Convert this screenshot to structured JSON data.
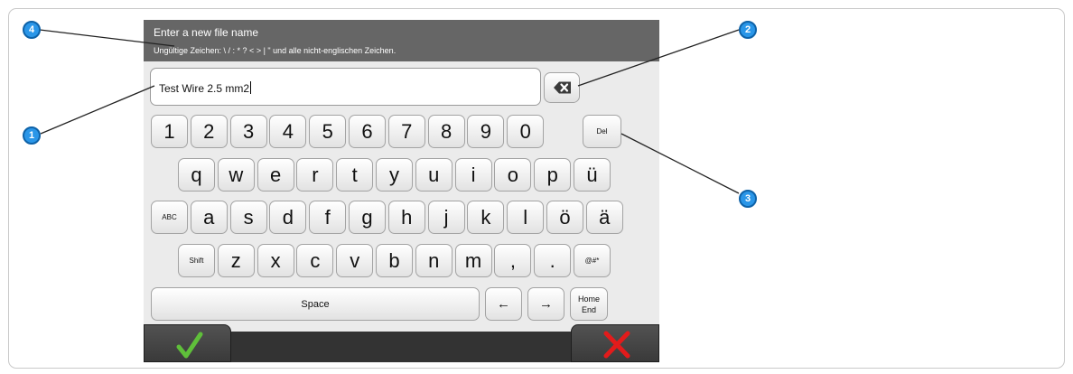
{
  "dialog": {
    "title": "Enter a new file name",
    "invalid_chars_note": "Ungültige Zeichen: \\ / : * ? < > | \" und alle nicht-englischen Zeichen."
  },
  "input": {
    "value": "Test Wire 2.5 mm2"
  },
  "keyboard": {
    "row1": [
      "1",
      "2",
      "3",
      "4",
      "5",
      "6",
      "7",
      "8",
      "9",
      "0",
      "Del"
    ],
    "row2": [
      "q",
      "w",
      "e",
      "r",
      "t",
      "y",
      "u",
      "i",
      "o",
      "p",
      "ü"
    ],
    "row3": [
      "ABC",
      "a",
      "s",
      "d",
      "f",
      "g",
      "h",
      "j",
      "k",
      "l",
      "ö",
      "ä"
    ],
    "row4": [
      "Shift",
      "z",
      "x",
      "c",
      "v",
      "b",
      "n",
      "m",
      ",",
      ".",
      "@#*"
    ],
    "row5": {
      "space": "Space",
      "left": "←",
      "right": "→",
      "home": "Home",
      "end": "End"
    }
  },
  "icons": {
    "backspace": "backspace-icon",
    "confirm": "checkmark-icon",
    "cancel": "x-icon"
  },
  "callouts": [
    "1",
    "2",
    "3",
    "4"
  ],
  "colors": {
    "header_bg": "#666666",
    "callout": "#2a96e8",
    "confirm": "#5fbf3a",
    "cancel": "#e31b1b"
  }
}
